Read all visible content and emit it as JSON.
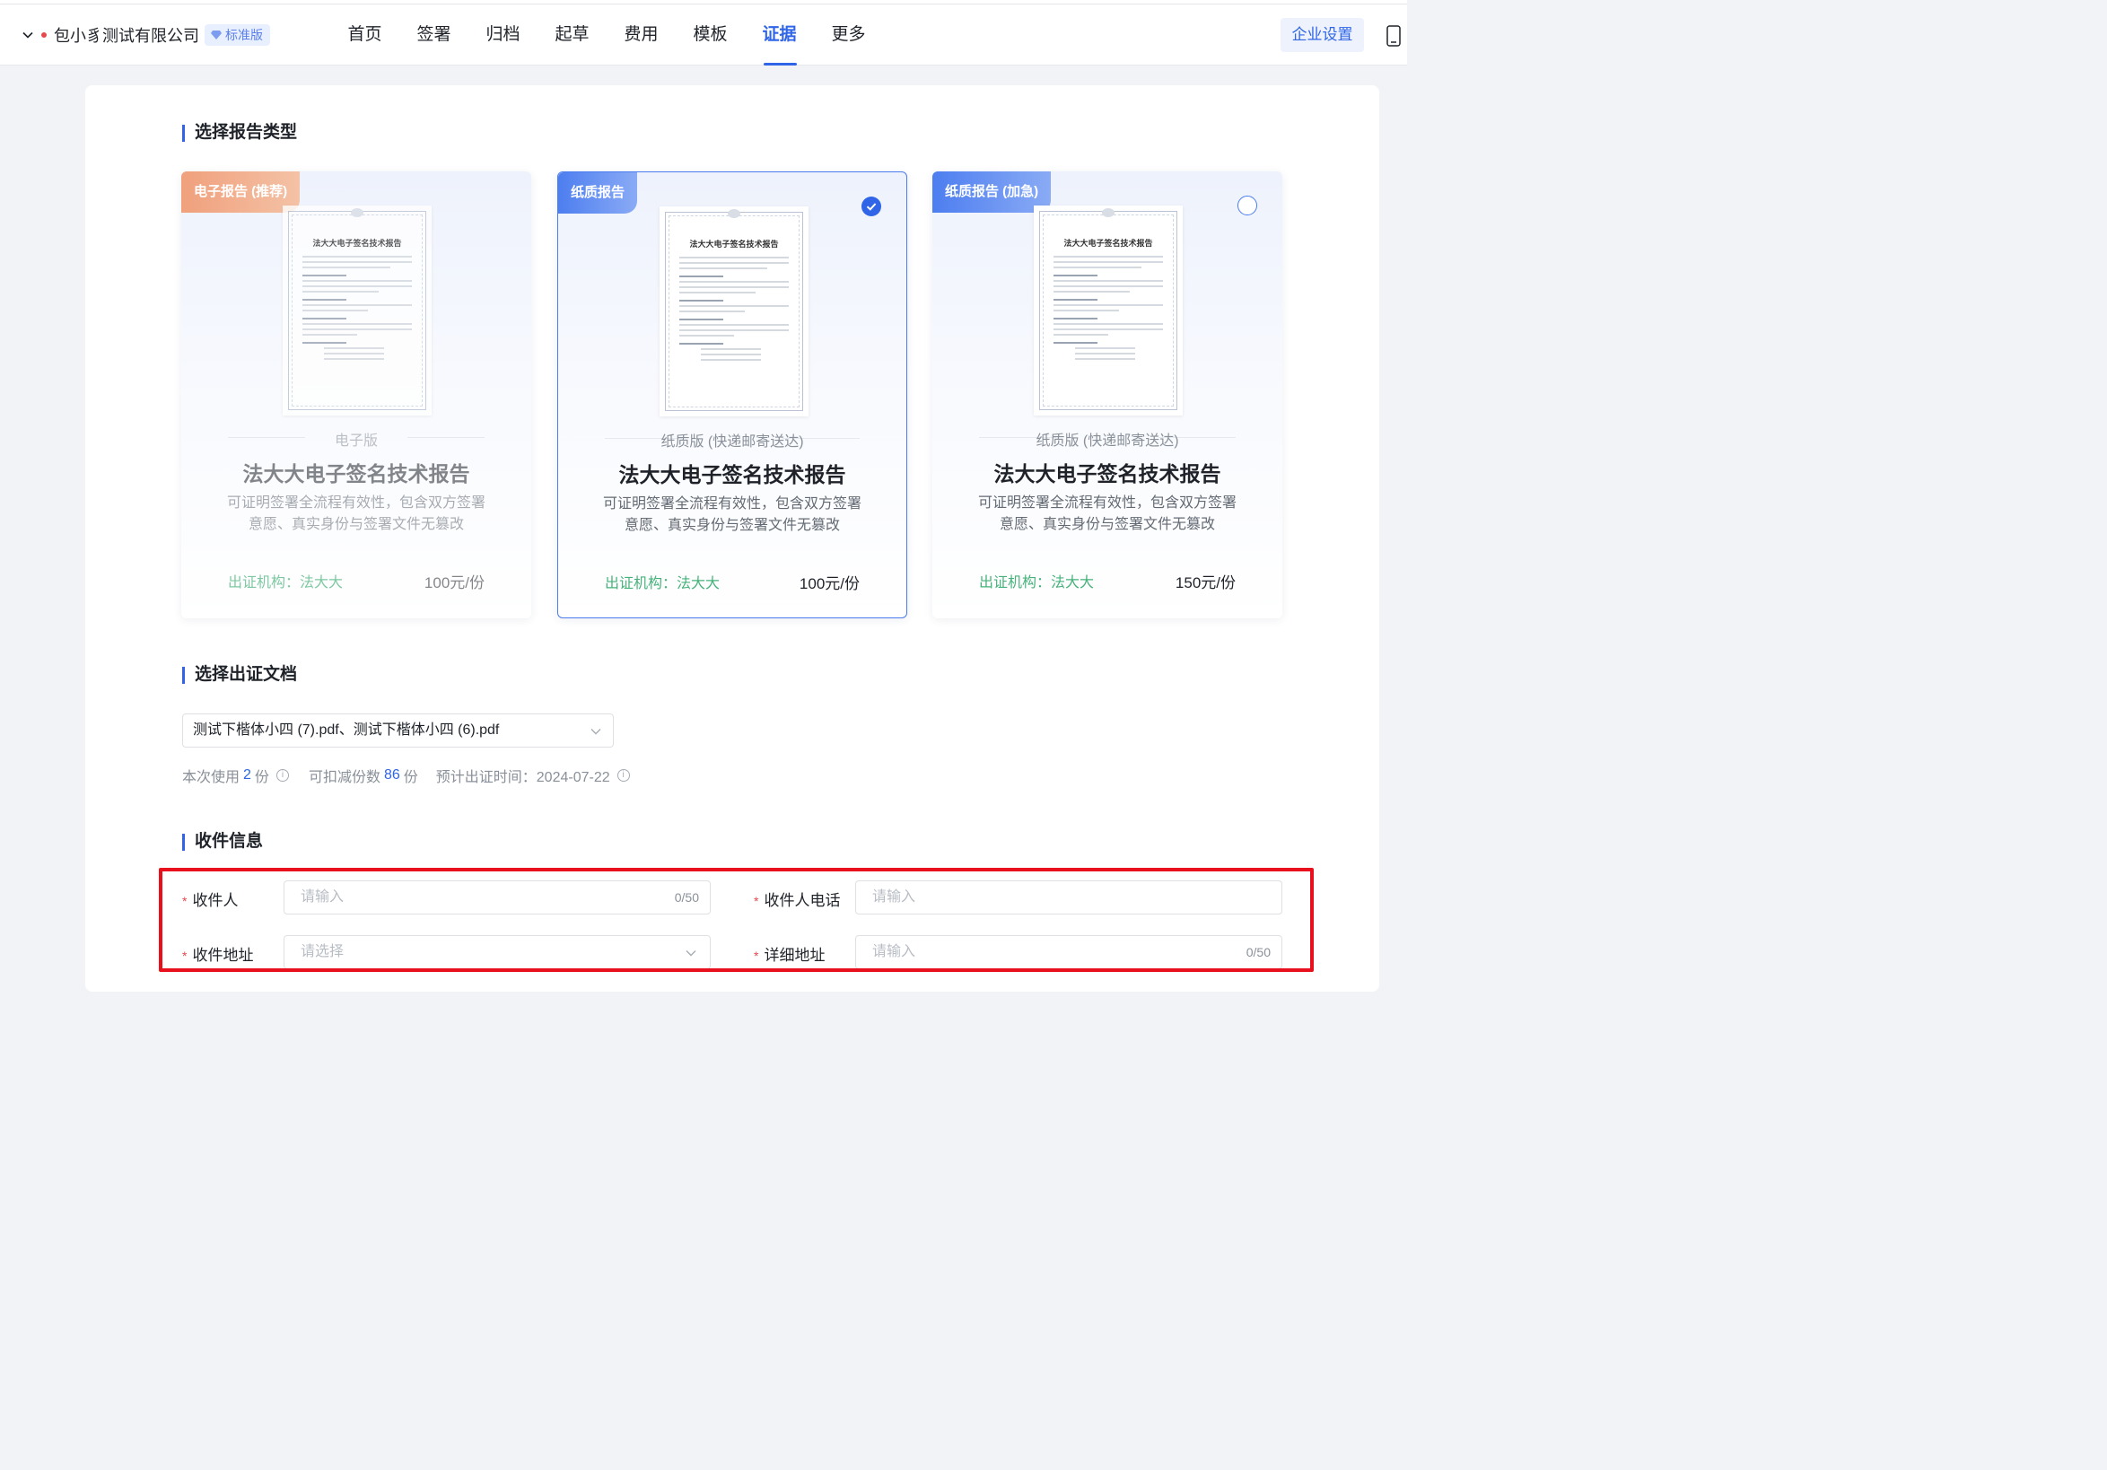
{
  "header": {
    "org_name": "包小豸测试有限公司",
    "plan_badge": "标准版",
    "nav": [
      "首页",
      "签署",
      "归档",
      "起草",
      "费用",
      "模板",
      "证据",
      "更多"
    ],
    "active_nav": "证据",
    "enterprise_settings": "企业设置"
  },
  "section_report_type": {
    "title": "选择报告类型"
  },
  "report_cards": [
    {
      "tag": "电子报告 (推荐)",
      "tag_color": "#f0a07c",
      "edition": "电子版",
      "title": "法大大电子签名技术报告",
      "desc": "可证明签署全流程有效性，包含双方签署意愿、真实身份与签署文件无篡改",
      "issuer": "出证机构：法大大",
      "price": "100元/份",
      "selected": false,
      "doc_title": "法大大电子签名技术报告"
    },
    {
      "tag": "纸质报告",
      "tag_color": "#4d7ef0",
      "edition": "纸质版 (快递邮寄送达)",
      "title": "法大大电子签名技术报告",
      "desc": "可证明签署全流程有效性，包含双方签署意愿、真实身份与签署文件无篡改",
      "issuer": "出证机构：法大大",
      "price": "100元/份",
      "selected": true,
      "doc_title": "法大大电子签名技术报告"
    },
    {
      "tag": "纸质报告 (加急)",
      "tag_color": "#4d7ef0",
      "edition": "纸质版 (快递邮寄送达)",
      "title": "法大大电子签名技术报告",
      "desc": "可证明签署全流程有效性，包含双方签署意愿、真实身份与签署文件无篡改",
      "issuer": "出证机构：法大大",
      "price": "150元/份",
      "selected": false,
      "doc_title": "法大大电子签名技术报告"
    }
  ],
  "section_docs": {
    "title": "选择出证文档",
    "selected_docs": "测试下楷体小四 (7).pdf、测试下楷体小四 (6).pdf",
    "usage_prefix": "本次使用",
    "usage_count": "2",
    "usage_unit": "份",
    "deductible_label": "可扣减份数",
    "deductible_count": "86",
    "deductible_unit": "份",
    "eta_label": "预计出证时间：2024-07-22"
  },
  "section_recipient": {
    "title": "收件信息",
    "recipient_label": "收件人",
    "recipient_placeholder": "请输入",
    "recipient_count": "0/50",
    "phone_label": "收件人电话",
    "phone_placeholder": "请输入",
    "address_label": "收件地址",
    "address_placeholder": "请选择",
    "detail_label": "详细地址",
    "detail_placeholder": "请输入",
    "detail_count": "0/50"
  }
}
